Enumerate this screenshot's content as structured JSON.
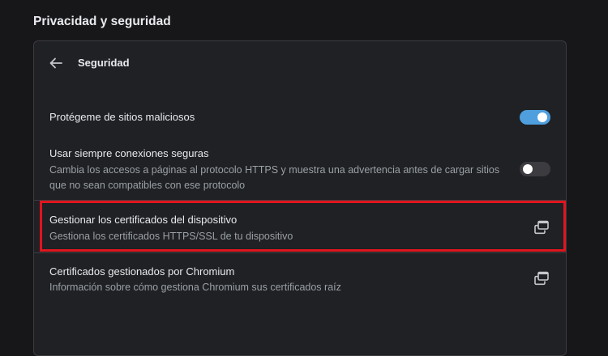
{
  "section_title": "Privacidad y seguridad",
  "page": {
    "title": "Seguridad",
    "back_icon": "arrow-left-icon"
  },
  "settings": [
    {
      "label": "Protégeme de sitios maliciosos",
      "control": "toggle",
      "checked": true
    },
    {
      "label": "Usar siempre conexiones seguras",
      "sublabel_line1": "Cambia los accesos a páginas al protocolo HTTPS y muestra una advertencia antes de cargar sitios",
      "sublabel_line2": "que no sean compatibles con ese protocolo",
      "control": "toggle",
      "checked": false
    },
    {
      "label": "Gestionar los certificados del dispositivo",
      "sublabel": "Gestiona los certificados HTTPS/SSL de tu dispositivo",
      "control": "external-link-icon",
      "highlighted": true
    },
    {
      "label": "Certificados gestionados por Chromium",
      "sublabel": "Información sobre cómo gestiona Chromium sus certificados raíz",
      "control": "external-link-icon"
    }
  ],
  "colors": {
    "background": "#171719",
    "card": "#202124",
    "toggle_on": "#4f9fdf",
    "highlight_border": "#e0151f"
  }
}
